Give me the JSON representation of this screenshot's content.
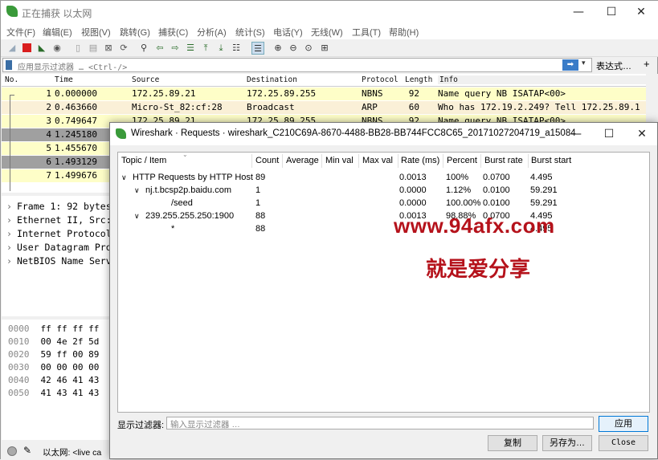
{
  "main": {
    "title": "正在捕获 以太网",
    "menu": [
      "文件(F)",
      "编辑(E)",
      "视图(V)",
      "跳转(G)",
      "捕获(C)",
      "分析(A)",
      "统计(S)",
      "电话(Y)",
      "无线(W)",
      "工具(T)",
      "帮助(H)"
    ],
    "filter_placeholder": "应用显示过滤器 … <Ctrl-/>",
    "expression_label": "表达式…",
    "plus": "+",
    "packet_columns": [
      "No.",
      "Time",
      "Source",
      "Destination",
      "Protocol",
      "Length",
      "Info"
    ],
    "packets": [
      {
        "no": "1",
        "time": "0.000000",
        "src": "172.25.89.21",
        "dst": "172.25.89.255",
        "proto": "NBNS",
        "len": "92",
        "info": "Name query NB ISATAP<00>",
        "bg": "#fefec8"
      },
      {
        "no": "2",
        "time": "0.463660",
        "src": "Micro-St_82:cf:28",
        "dst": "Broadcast",
        "proto": "ARP",
        "len": "60",
        "info": "Who has 172.19.2.249? Tell 172.25.89.1",
        "bg": "#faf0d7"
      },
      {
        "no": "3",
        "time": "0.749647",
        "src": "172.25.89.21",
        "dst": "172.25.89.255",
        "proto": "NBNS",
        "len": "92",
        "info": "Name query NB ISATAP<00>",
        "bg": "#fefec8"
      },
      {
        "no": "4",
        "time": "1.245180",
        "src": "",
        "dst": "",
        "proto": "",
        "len": "",
        "info": "",
        "bg": "#a0a0a0"
      },
      {
        "no": "5",
        "time": "1.455670",
        "src": "",
        "dst": "",
        "proto": "",
        "len": "",
        "info": "",
        "bg": "#fefec8"
      },
      {
        "no": "6",
        "time": "1.493129",
        "src": "",
        "dst": "",
        "proto": "",
        "len": "",
        "info": "",
        "bg": "#a0a0a0"
      },
      {
        "no": "7",
        "time": "1.499676",
        "src": "",
        "dst": "",
        "proto": "",
        "len": "",
        "info": "",
        "bg": "#fefec8"
      }
    ],
    "details": [
      "Frame 1: 92 bytes",
      "Ethernet II, Src:",
      "Internet Protocol",
      "User Datagram Pro",
      "NetBIOS Name Serv"
    ],
    "bytes": [
      {
        "off": "0000",
        "hex": "ff ff ff ff"
      },
      {
        "off": "0010",
        "hex": "00 4e 2f 5d"
      },
      {
        "off": "0020",
        "hex": "59 ff 00 89"
      },
      {
        "off": "0030",
        "hex": "00 00 00 00"
      },
      {
        "off": "0040",
        "hex": "42 46 41 43"
      },
      {
        "off": "0050",
        "hex": "41 43 41 43"
      }
    ],
    "status_text": "以太网: <live ca"
  },
  "dialog": {
    "title": "Wireshark · Requests · wireshark_C210C69A-8670-4488-BB28-BB744FCC8C65_20171027204719_a15084",
    "columns": [
      "Topic / Item",
      "Count",
      "Average",
      "Min val",
      "Max val",
      "Rate (ms)",
      "Percent",
      "Burst rate",
      "Burst start"
    ],
    "rows": [
      {
        "topic": "HTTP Requests by HTTP Host",
        "count": "89",
        "rate": "0.0013",
        "percent": "100%",
        "burst": "0.0700",
        "start": "4.495",
        "level": 0,
        "arrow": "∨"
      },
      {
        "topic": "nj.t.bcsp2p.baidu.com",
        "count": "1",
        "rate": "0.0000",
        "percent": "1.12%",
        "burst": "0.0100",
        "start": "59.291",
        "level": 1,
        "arrow": "∨"
      },
      {
        "topic": "/seed",
        "count": "1",
        "rate": "0.0000",
        "percent": "100.00%",
        "burst": "0.0100",
        "start": "59.291",
        "level": 2,
        "arrow": ""
      },
      {
        "topic": "239.255.255.250:1900",
        "count": "88",
        "rate": "0.0013",
        "percent": "98.88%",
        "burst": "0.0700",
        "start": "4.495",
        "level": 1,
        "arrow": "∨"
      },
      {
        "topic": "*",
        "count": "88",
        "rate": "",
        "percent": "",
        "burst": "",
        "start": "4.495",
        "level": 2,
        "arrow": ""
      }
    ],
    "filter_label": "显示过滤器:",
    "filter_placeholder": "输入显示过滤器 …",
    "apply": "应用",
    "copy": "复制",
    "save_as": "另存为…",
    "close": "Close"
  },
  "watermark": {
    "line1": "www.94afx.com",
    "line2": "就是爱分享"
  }
}
